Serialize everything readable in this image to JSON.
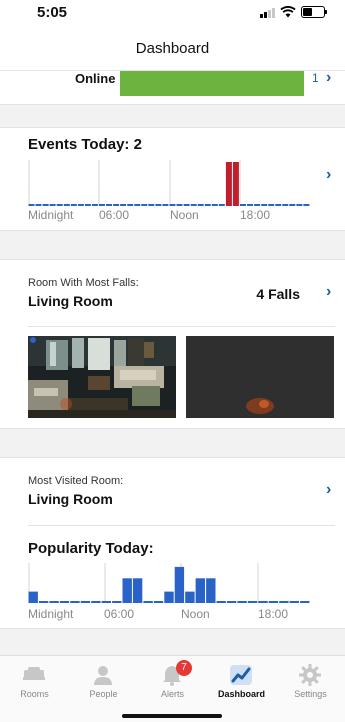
{
  "status": {
    "time": "5:05"
  },
  "nav": {
    "title": "Dashboard"
  },
  "online": {
    "label": "Online",
    "count": "1",
    "bar_color": "#6cb33f"
  },
  "events": {
    "title": "Events Today: 2",
    "ticks": [
      "Midnight",
      "06:00",
      "Noon",
      "18:00"
    ]
  },
  "falls": {
    "room_label": "Room With Most Falls:",
    "room_name": "Living Room",
    "count_label": "4 Falls"
  },
  "visited": {
    "label": "Most Visited Room:",
    "room_name": "Living Room"
  },
  "popularity": {
    "title": "Popularity Today:",
    "ticks": [
      "Midnight",
      "06:00",
      "Noon",
      "18:00"
    ]
  },
  "chart_data": [
    {
      "type": "bar",
      "title": "Events Today: 2",
      "x_ticks": [
        "Midnight",
        "06:00",
        "Noon",
        "18:00"
      ],
      "series": [
        {
          "values": [
            0,
            0,
            0,
            0,
            0,
            0,
            0,
            0,
            0,
            0,
            0,
            0,
            0,
            0,
            0,
            0,
            0,
            0,
            0,
            0,
            0,
            0,
            0,
            0,
            0,
            0,
            0,
            0,
            1,
            1,
            0,
            0,
            0,
            0,
            0,
            0,
            0,
            0,
            0,
            0
          ]
        }
      ],
      "colors": {
        "bar": "#c0202e",
        "baseline": "#2a63c8"
      }
    },
    {
      "type": "bar",
      "title": "Popularity Today:",
      "x_ticks": [
        "Midnight",
        "06:00",
        "Noon",
        "18:00"
      ],
      "series": [
        {
          "values": [
            0.3,
            0,
            0,
            0,
            0,
            0,
            0,
            0,
            0,
            0.65,
            0.65,
            0,
            0,
            0.3,
            0.95,
            0.3,
            0.65,
            0.65,
            0,
            0,
            0,
            0,
            0,
            0,
            0,
            0,
            0
          ]
        }
      ],
      "colors": {
        "bar": "#2a63c8",
        "baseline": "#2a63c8"
      }
    }
  ],
  "tabs": [
    {
      "label": "Rooms",
      "icon": "bed-icon"
    },
    {
      "label": "People",
      "icon": "person-icon"
    },
    {
      "label": "Alerts",
      "icon": "bell-icon",
      "badge": "7"
    },
    {
      "label": "Dashboard",
      "icon": "dashboard-chart-icon",
      "active": true
    },
    {
      "label": "Settings",
      "icon": "gear-icon"
    }
  ]
}
